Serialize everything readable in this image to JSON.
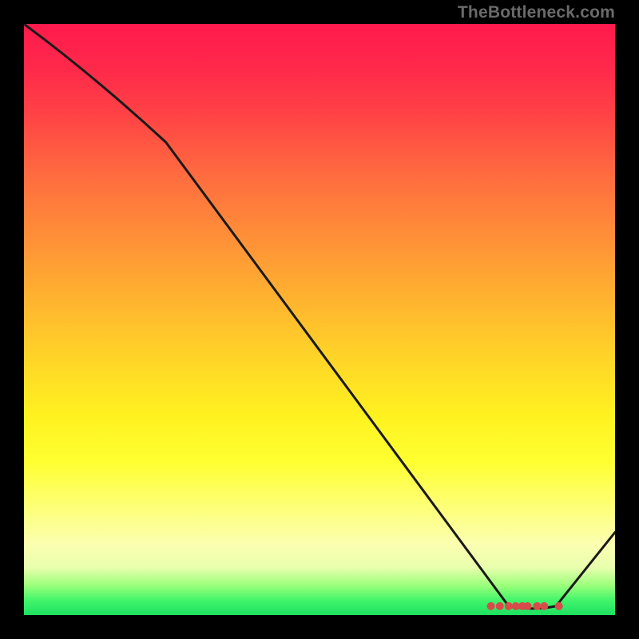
{
  "watermark": "TheBottleneck.com",
  "chart_data": {
    "type": "line",
    "title": "",
    "xlabel": "",
    "ylabel": "",
    "xlim": [
      0,
      100
    ],
    "ylim": [
      0,
      100
    ],
    "grid": false,
    "series": [
      {
        "name": "curve",
        "x": [
          0,
          24,
          82,
          90,
          100
        ],
        "y": [
          100,
          80,
          1.5,
          1.5,
          14
        ]
      }
    ],
    "markers": {
      "name": "bottom-cluster",
      "points": [
        {
          "x": 79.0,
          "y": 1.5
        },
        {
          "x": 80.5,
          "y": 1.5
        },
        {
          "x": 82.0,
          "y": 1.5
        },
        {
          "x": 83.2,
          "y": 1.5
        },
        {
          "x": 84.3,
          "y": 1.5
        },
        {
          "x": 85.2,
          "y": 1.5
        },
        {
          "x": 86.8,
          "y": 1.5
        },
        {
          "x": 88.0,
          "y": 1.5
        },
        {
          "x": 90.5,
          "y": 1.5
        }
      ],
      "color": "#d94a4a",
      "radius_px": 5.0
    }
  },
  "colors": {
    "curve": "#1a1a1a",
    "marker": "#d94a4a",
    "background_top": "#ff1a4d",
    "background_bottom": "#1de060",
    "frame": "#000000",
    "watermark": "#6a6a6a"
  }
}
